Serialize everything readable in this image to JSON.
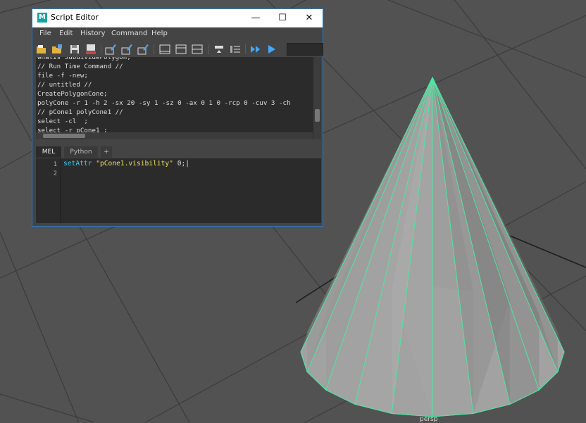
{
  "viewport": {
    "camera_label": "persp"
  },
  "window": {
    "title": "Script Editor",
    "app_icon_letter": "M",
    "buttons": {
      "minimize": "—",
      "maximize": "☐",
      "close": "✕"
    }
  },
  "menu": [
    "File",
    "Edit",
    "History",
    "Command",
    "Help"
  ],
  "toolbar_icons": [
    "open-script-icon",
    "source-script-icon",
    "save-script-icon",
    "save-to-shelf-icon",
    "clear-history-icon",
    "clear-input-icon",
    "clear-all-icon",
    "show-history-only-icon",
    "show-input-only-icon",
    "show-both-icon",
    "echo-all-commands-icon",
    "line-numbers-icon",
    "execute-all-icon",
    "execute-icon"
  ],
  "history_lines": [
    "whatIs SubdividePolygon;",
    "// Run Time Command //",
    "file -f -new;",
    "// untitled //",
    "CreatePolygonCone;",
    "polyCone -r 1 -h 2 -sx 20 -sy 1 -sz 0 -ax 0 1 0 -rcp 0 -cuv 3 -ch",
    "// pCone1 polyCone1 //",
    "select -cl  ;",
    "select -r pCone1 ;"
  ],
  "tabs": [
    "MEL",
    "Python",
    "+"
  ],
  "input": {
    "line_numbers": [
      "1",
      "2"
    ],
    "code_command": "setAttr ",
    "code_string": "\"pCone1.visibility\"",
    "code_rest": " 0;"
  },
  "colors": {
    "accent": "#2b79c2",
    "cone_wire": "#4ee6a0",
    "mel_command": "#3ecbf0",
    "mel_string": "#f0e060"
  }
}
